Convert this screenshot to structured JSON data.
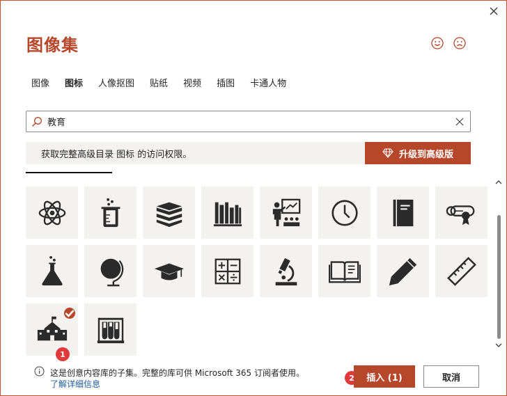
{
  "dialog": {
    "title": "图像集"
  },
  "tabs": [
    {
      "label": "图像"
    },
    {
      "label": "图标"
    },
    {
      "label": "人像抠图"
    },
    {
      "label": "贴纸"
    },
    {
      "label": "视频"
    },
    {
      "label": "插图"
    },
    {
      "label": "卡通人物"
    }
  ],
  "active_tab": "图标",
  "search": {
    "value": "教育"
  },
  "banner": {
    "message": "获取完整高级目录 图标 的访问权限。",
    "upgrade_label": "升级到高级版"
  },
  "icons": [
    {
      "name": "atom-icon"
    },
    {
      "name": "beaker-icon"
    },
    {
      "name": "books-stack-icon"
    },
    {
      "name": "bookshelf-icon"
    },
    {
      "name": "teacher-icon"
    },
    {
      "name": "clock-icon"
    },
    {
      "name": "notebook-icon"
    },
    {
      "name": "diploma-icon"
    },
    {
      "name": "flask-icon"
    },
    {
      "name": "globe-icon"
    },
    {
      "name": "graduation-cap-icon"
    },
    {
      "name": "calculator-icon"
    },
    {
      "name": "microscope-icon"
    },
    {
      "name": "open-book-icon"
    },
    {
      "name": "pencil-icon"
    },
    {
      "name": "ruler-icon"
    },
    {
      "name": "school-icon",
      "selected": true
    },
    {
      "name": "test-tubes-icon"
    }
  ],
  "badges": {
    "one": "1",
    "two": "2"
  },
  "footer": {
    "info_text": "这是创意内容库的子集。完整的库可供 Microsoft 365 订阅者使用。",
    "link_text": "了解详细信息"
  },
  "buttons": {
    "insert_label": "插入 (1)",
    "cancel_label": "取消"
  },
  "colors": {
    "accent": "#b7472a",
    "badge": "#e03a3a",
    "link": "#1f5c9e"
  }
}
